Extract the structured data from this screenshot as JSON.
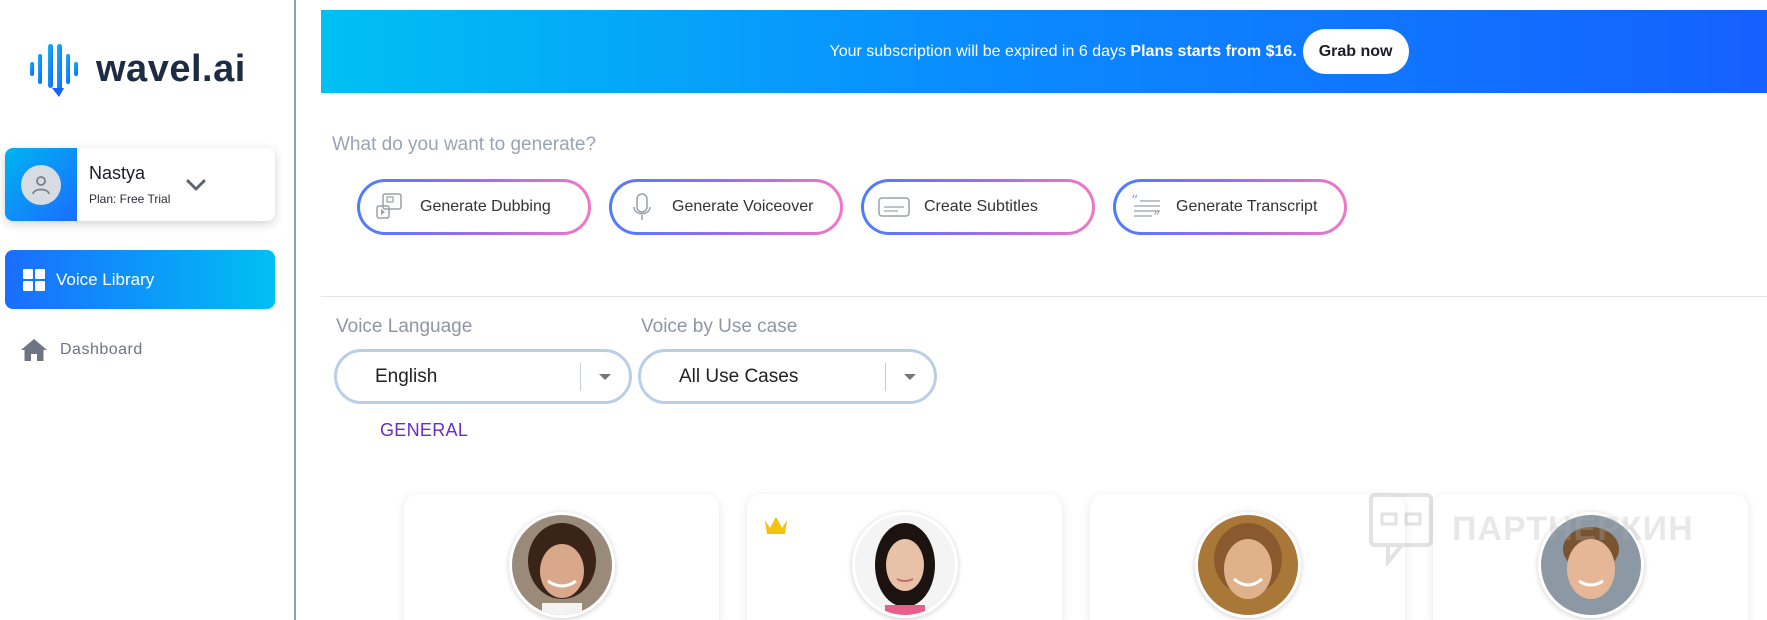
{
  "brand": {
    "name": "wavel.ai",
    "accent": "#1a6dff"
  },
  "user": {
    "name": "Nastya",
    "plan": "Plan: Free Trial"
  },
  "nav": {
    "active": {
      "label": "Voice Library",
      "icon": "grid-icon"
    },
    "items": [
      {
        "label": "Dashboard",
        "icon": "home-icon"
      }
    ]
  },
  "banner": {
    "text": "Your subscription will be expired in 6 days",
    "emphasis": "Plans starts from $16.",
    "button": "Grab now"
  },
  "generate": {
    "question": "What do you want to generate?",
    "options": [
      {
        "label": "Generate Dubbing",
        "icon": "dubbing-icon"
      },
      {
        "label": "Generate Voiceover",
        "icon": "microphone-icon"
      },
      {
        "label": "Create Subtitles",
        "icon": "subtitles-icon"
      },
      {
        "label": "Generate Transcript",
        "icon": "transcript-icon"
      }
    ]
  },
  "filters": {
    "language": {
      "label": "Voice Language",
      "value": "English"
    },
    "usecase": {
      "label": "Voice by Use case",
      "value": "All Use Cases"
    }
  },
  "category": "GENERAL",
  "voices": [
    {
      "name": "",
      "premium": false,
      "skin": "#d9a88a",
      "hair": "#3a2418"
    },
    {
      "name": "",
      "premium": true,
      "skin": "#e8c2a8",
      "hair": "#1c1210"
    },
    {
      "name": "",
      "premium": false,
      "skin": "#e0b28c",
      "hair": "#8a5a2e"
    },
    {
      "name": "",
      "premium": false,
      "skin": "#e6b796",
      "hair": "#7a5330"
    }
  ],
  "watermark": "ПАРТНЕРКИН"
}
